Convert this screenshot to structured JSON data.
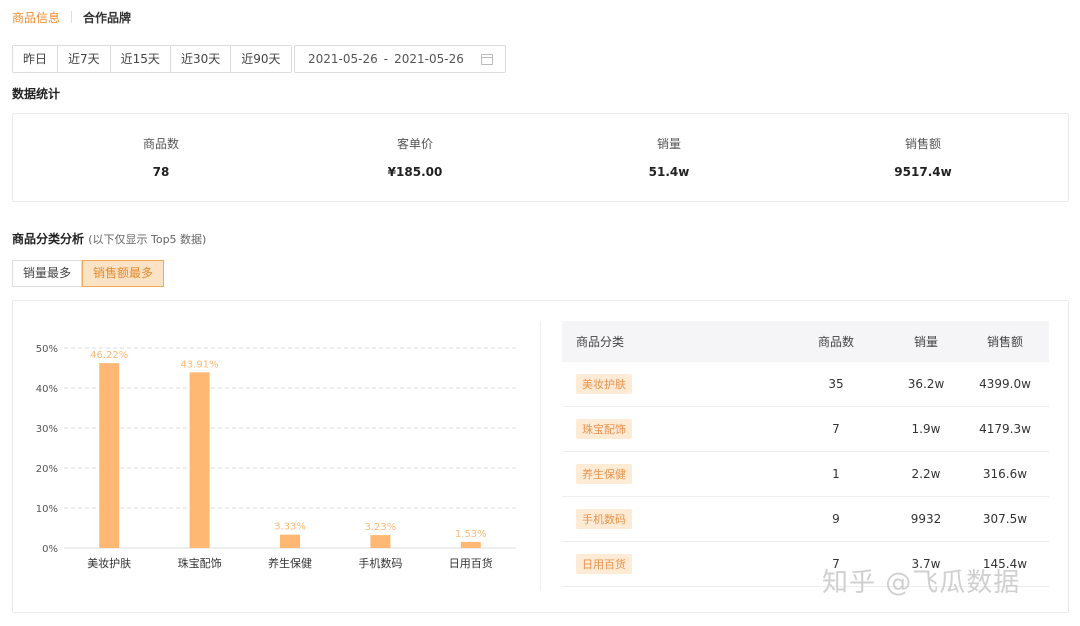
{
  "tabs": [
    "商品信息",
    "合作品牌"
  ],
  "date_ranges": [
    "昨日",
    "近7天",
    "近15天",
    "近30天",
    "近90天"
  ],
  "date_picker": {
    "start": "2021-05-26",
    "separator": "-",
    "end": "2021-05-26"
  },
  "stats_section": {
    "title": "数据统计"
  },
  "stats": [
    {
      "label": "商品数",
      "value": "78"
    },
    {
      "label": "客单价",
      "value": "¥185.00"
    },
    {
      "label": "销量",
      "value": "51.4w"
    },
    {
      "label": "销售额",
      "value": "9517.4w"
    }
  ],
  "category_section": {
    "title": "商品分类分析",
    "note": "(以下仅显示 Top5 数据)"
  },
  "sort_toggle": {
    "options": [
      "销量最多",
      "销售额最多"
    ],
    "selected": "销售额最多"
  },
  "chart_data": {
    "type": "bar",
    "categories": [
      "美妆护肤",
      "珠宝配饰",
      "养生保健",
      "手机数码",
      "日用百货"
    ],
    "values": [
      46.22,
      43.91,
      3.33,
      3.23,
      1.53
    ],
    "data_labels": [
      "46.22%",
      "43.91%",
      "3.33%",
      "3.23%",
      "1.53%"
    ],
    "yticks": [
      "0%",
      "10%",
      "20%",
      "30%",
      "40%",
      "50%"
    ],
    "ylim": [
      0,
      50
    ],
    "grid": true,
    "bar_color": "#ffb873",
    "label_color": "#ffb873"
  },
  "table": {
    "headers": [
      "商品分类",
      "商品数",
      "销量",
      "销售额"
    ],
    "rows": [
      [
        "美妆护肤",
        "35",
        "36.2w",
        "4399.0w"
      ],
      [
        "珠宝配饰",
        "7",
        "1.9w",
        "4179.3w"
      ],
      [
        "养生保健",
        "1",
        "2.2w",
        "316.6w"
      ],
      [
        "手机数码",
        "9",
        "9932",
        "307.5w"
      ],
      [
        "日用百货",
        "7",
        "3.7w",
        "145.4w"
      ]
    ]
  },
  "watermark": "知乎 @飞瓜数据",
  "colors": {
    "accent": "#f08c2b",
    "tag_bg": "#fdebd6",
    "tag_text": "#e8934a"
  }
}
